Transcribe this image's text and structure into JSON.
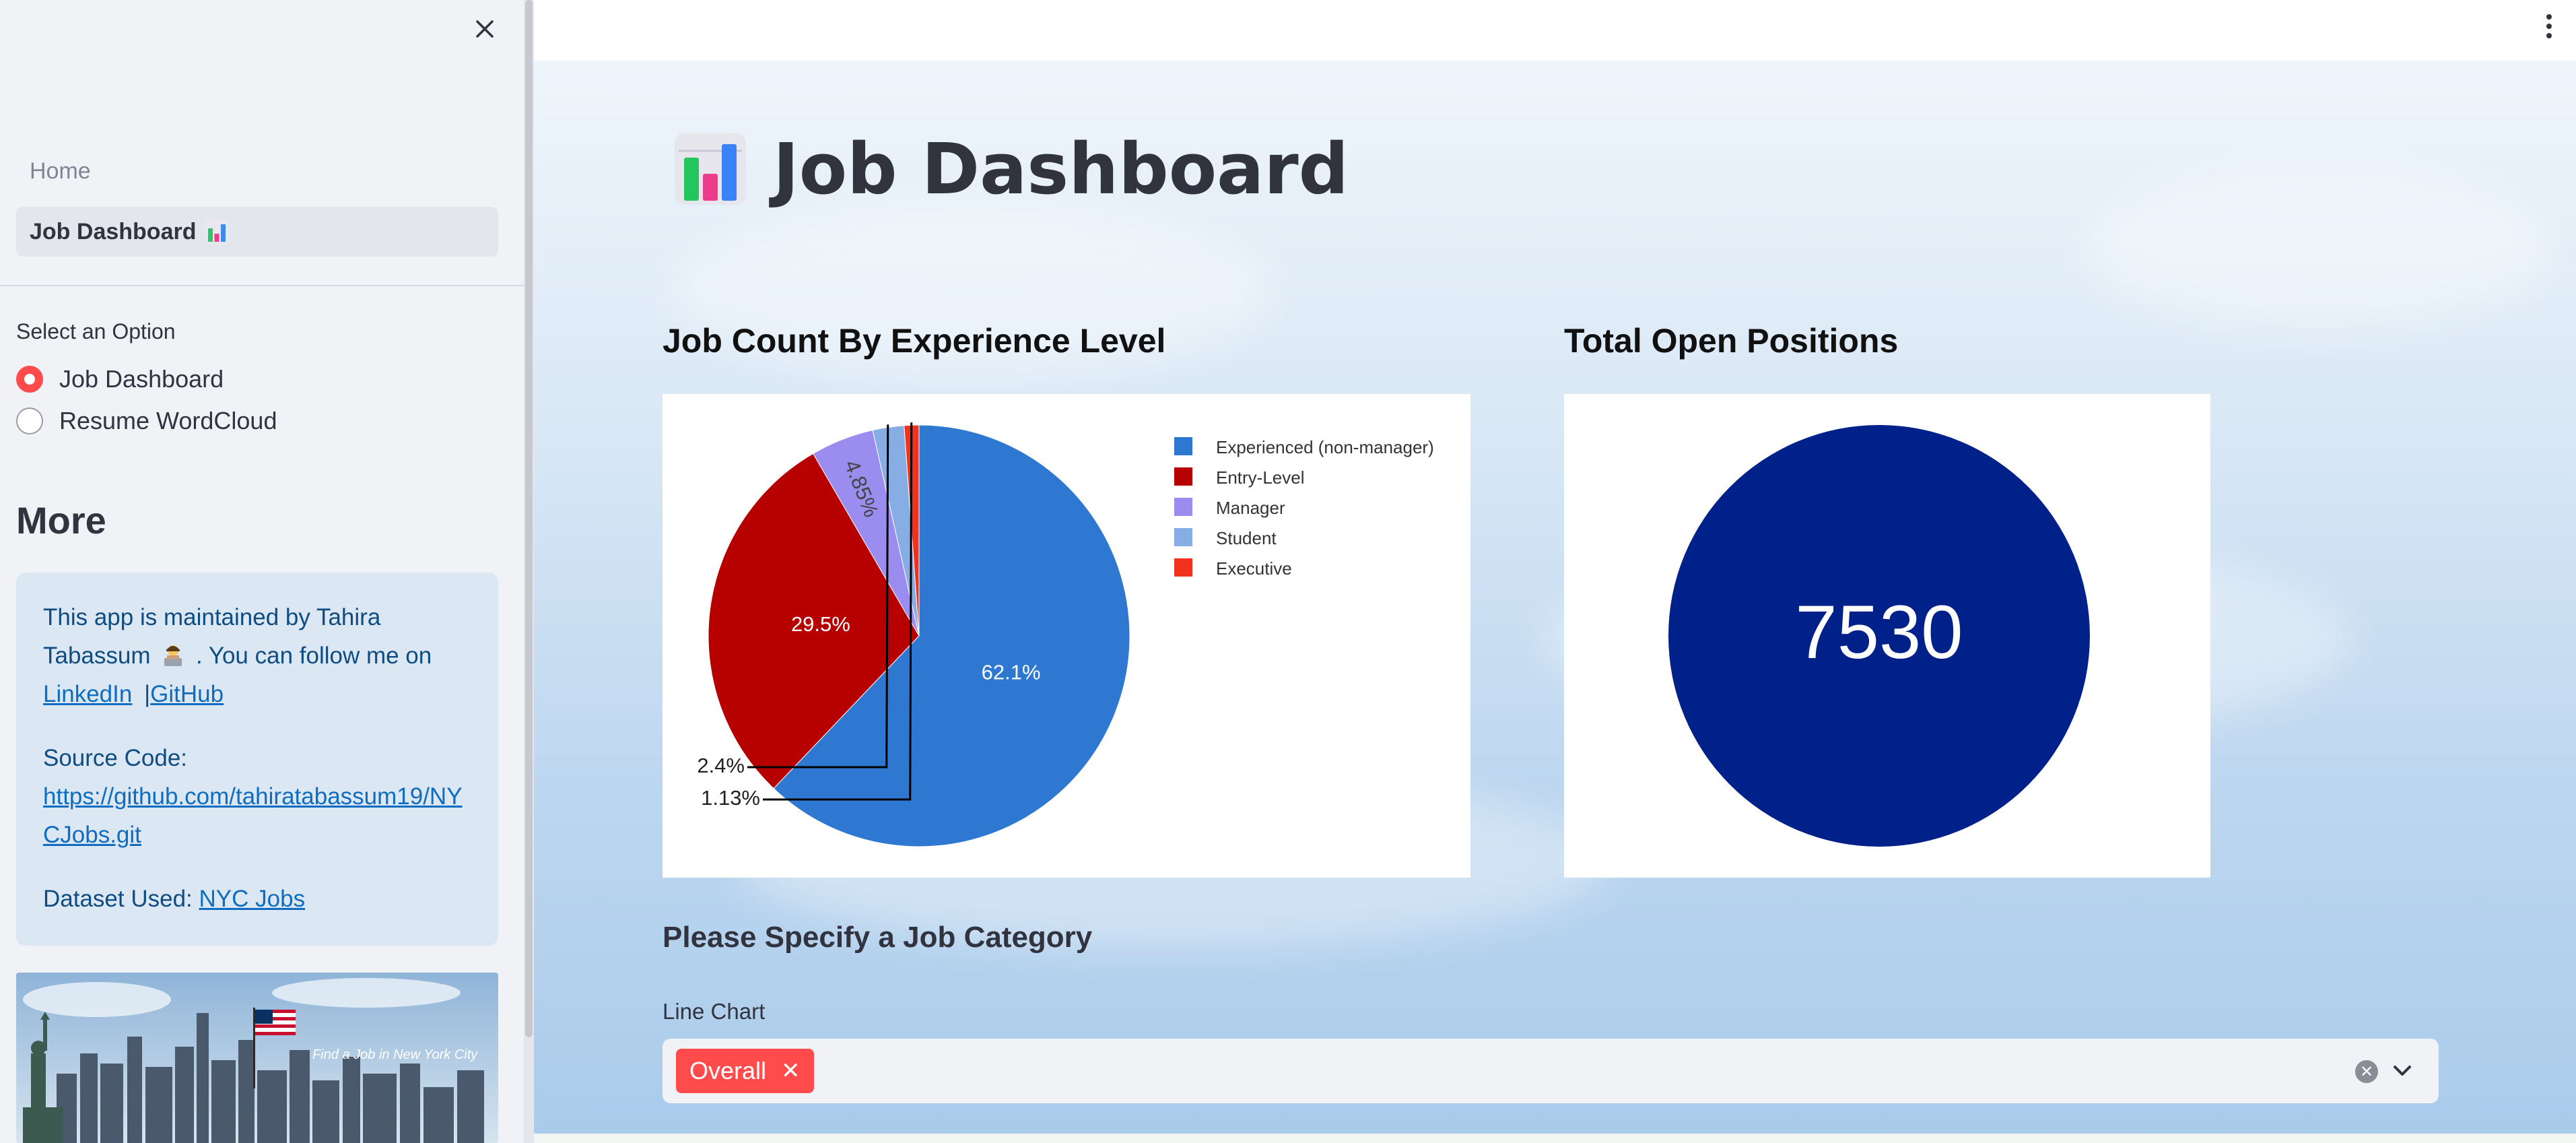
{
  "sidebar": {
    "nav": {
      "home_label": "Home",
      "active_label": "Job Dashboard"
    },
    "select_label": "Select an Option",
    "options": [
      {
        "label": "Job Dashboard",
        "selected": true
      },
      {
        "label": "Resume WordCloud",
        "selected": false
      }
    ],
    "more_heading": "More",
    "info": {
      "maintained_prefix": "This app is maintained by Tahira Tabassum",
      "maintained_suffix": ". You can follow me on",
      "linkedin": "LinkedIn",
      "separator": "|",
      "github": "GitHub",
      "source_label": "Source Code:",
      "source_url": "https://github.com/tahiratabassum19/NYCJobs.git",
      "dataset_label": "Dataset Used:",
      "dataset_link": "NYC Jobs"
    },
    "image_caption": "Find a Job in New York City"
  },
  "main": {
    "title": "Job Dashboard",
    "pie_title": "Job Count By Experience Level",
    "total_title": "Total Open Positions",
    "total_value": "7530",
    "category_heading": "Please Specify a Job Category",
    "line_chart_label": "Line Chart",
    "selected_tags": [
      "Overall"
    ]
  },
  "chart_data": {
    "type": "pie",
    "title": "Job Count By Experience Level",
    "categories": [
      "Experienced (non-manager)",
      "Entry-Level",
      "Manager",
      "Student",
      "Executive"
    ],
    "values": [
      62.1,
      29.5,
      4.85,
      2.4,
      1.13
    ],
    "labels": [
      "62.1%",
      "29.5%",
      "4.85%",
      "2.4%",
      "1.13%"
    ],
    "colors": [
      "#2e78d2",
      "#b70000",
      "#9b8cf0",
      "#86aee4",
      "#f0321e"
    ],
    "legend_position": "top-right"
  },
  "colors": {
    "accent": "#ff4b4b",
    "total_circle": "#00208a",
    "info_box": "#dbe7f3"
  }
}
